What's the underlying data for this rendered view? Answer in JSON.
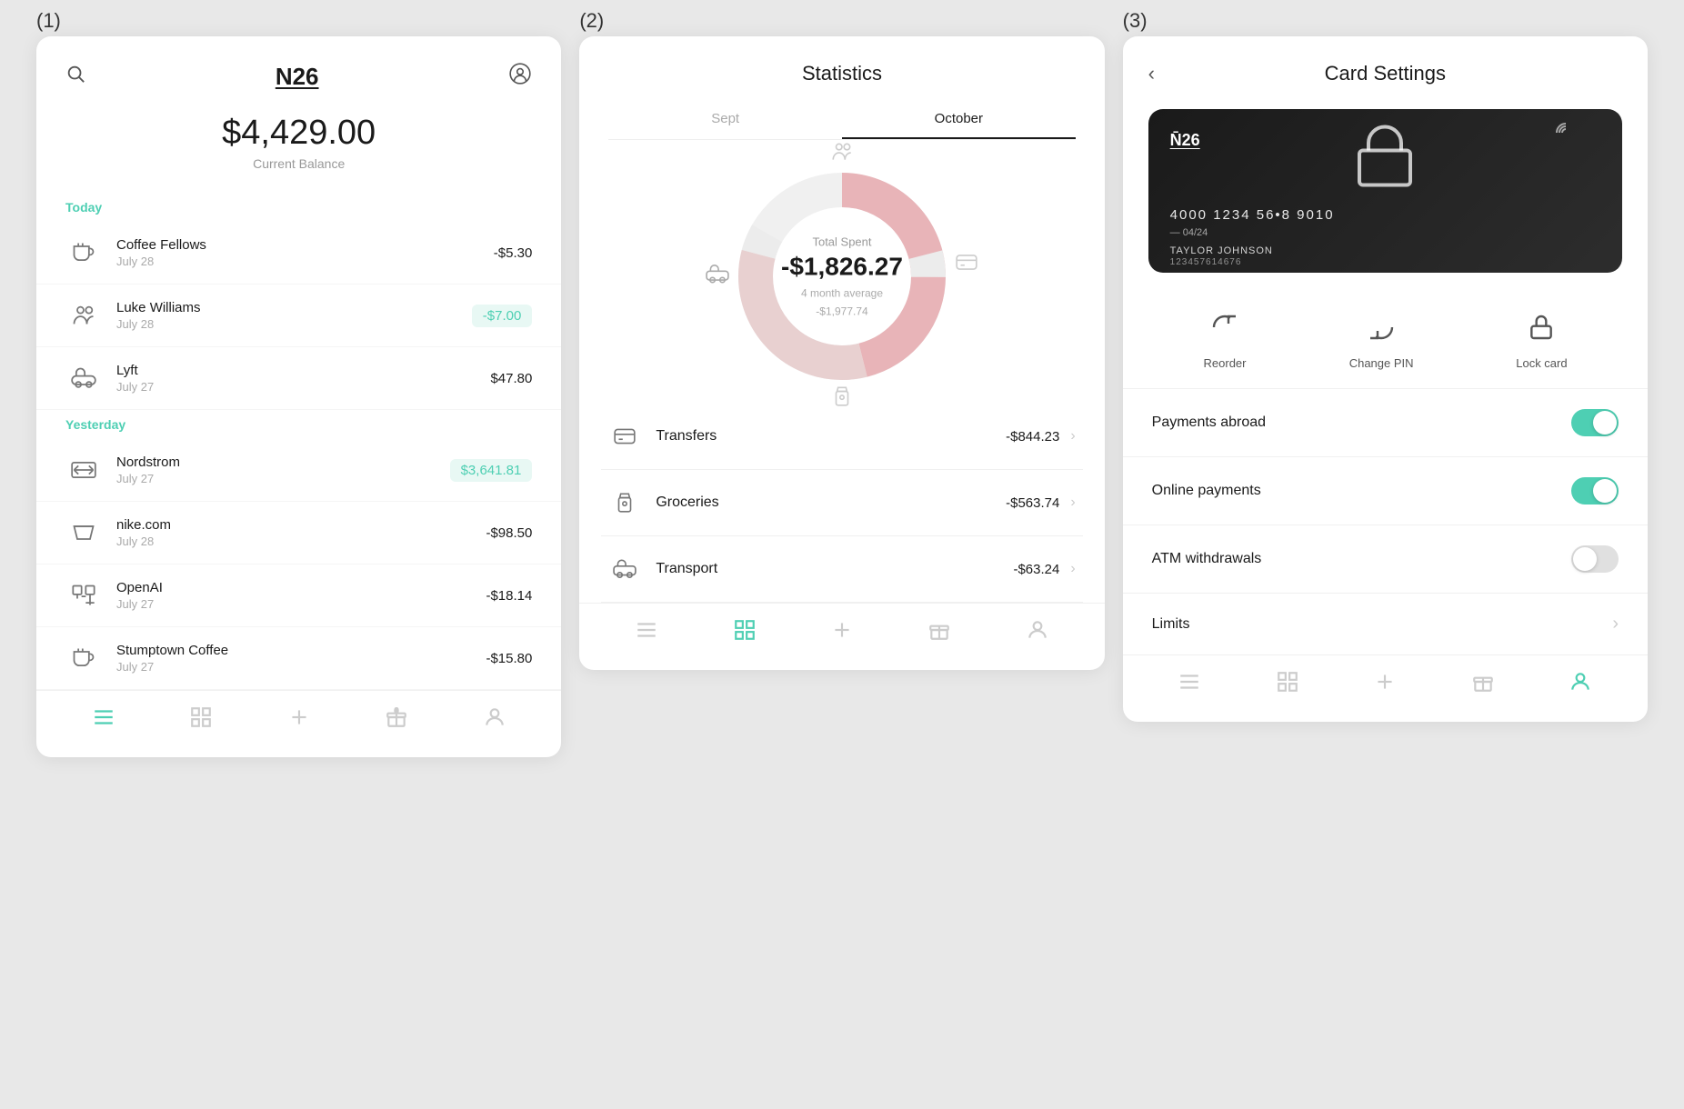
{
  "screens": {
    "s1": {
      "label": "(1)",
      "header": {
        "search_icon": "🔍",
        "logo": "N26",
        "avatar_icon": "⊙"
      },
      "balance": "$4,429.00",
      "balance_label": "Current Balance",
      "today_label": "Today",
      "yesterday_label": "Yesterday",
      "transactions": [
        {
          "group": "today",
          "icon": "🍴",
          "name": "Coffee Fellows",
          "date": "July 28",
          "amount": "-$5.30",
          "positive": false
        },
        {
          "group": "today",
          "icon": "👥",
          "name": "Luke Williams",
          "date": "July 28",
          "amount": "-$7.00",
          "positive": true
        },
        {
          "group": "today",
          "icon": "🚗",
          "name": "Lyft",
          "date": "July 27",
          "amount": "$47.80",
          "positive": false
        },
        {
          "group": "yesterday",
          "icon": "🏬",
          "name": "Nordstrom",
          "date": "July 27",
          "amount": "$3,641.81",
          "positive": true
        },
        {
          "group": "yesterday",
          "icon": "🛒",
          "name": "nike.com",
          "date": "July 28",
          "amount": "-$98.50",
          "positive": false
        },
        {
          "group": "yesterday",
          "icon": "💼",
          "name": "OpenAI",
          "date": "July 27",
          "amount": "-$18.14",
          "positive": false
        },
        {
          "group": "yesterday",
          "icon": "☕",
          "name": "Stumptown Coffee",
          "date": "July 27",
          "amount": "-$15.80",
          "positive": false
        }
      ],
      "nav": {
        "feed": "≡",
        "grid": "⊞",
        "add": "+",
        "gift": "🎁",
        "user": "👤"
      }
    },
    "s2": {
      "label": "(2)",
      "title": "Statistics",
      "tabs": [
        "Sept",
        "October"
      ],
      "active_tab": "October",
      "donut": {
        "total_label": "Total Spent",
        "total_amount": "-$1,826.27",
        "avg_label": "4 month average",
        "avg_amount": "-$1,977.74"
      },
      "categories": [
        {
          "icon": "💳",
          "name": "Transfers",
          "amount": "-$844.23"
        },
        {
          "icon": "🛒",
          "name": "Groceries",
          "amount": "-$563.74"
        },
        {
          "icon": "🚗",
          "name": "Transport",
          "amount": "-$63.24"
        }
      ]
    },
    "s3": {
      "label": "(3)",
      "back_icon": "<",
      "title": "Card Settings",
      "card": {
        "logo": "N26",
        "number": "4000  1234  56▪8  9010",
        "expiry": "04/24",
        "name": "TAYLOR JOHNSON",
        "subname": "123457614676"
      },
      "actions": [
        {
          "icon": "↺",
          "label": "Reorder"
        },
        {
          "icon": "↻",
          "label": "Change PIN"
        },
        {
          "icon": "🔒",
          "label": "Lock card"
        }
      ],
      "toggles": [
        {
          "label": "Payments abroad",
          "on": true
        },
        {
          "label": "Online payments",
          "on": true
        },
        {
          "label": "ATM withdrawals",
          "on": false
        }
      ],
      "limits_label": "Limits"
    }
  }
}
